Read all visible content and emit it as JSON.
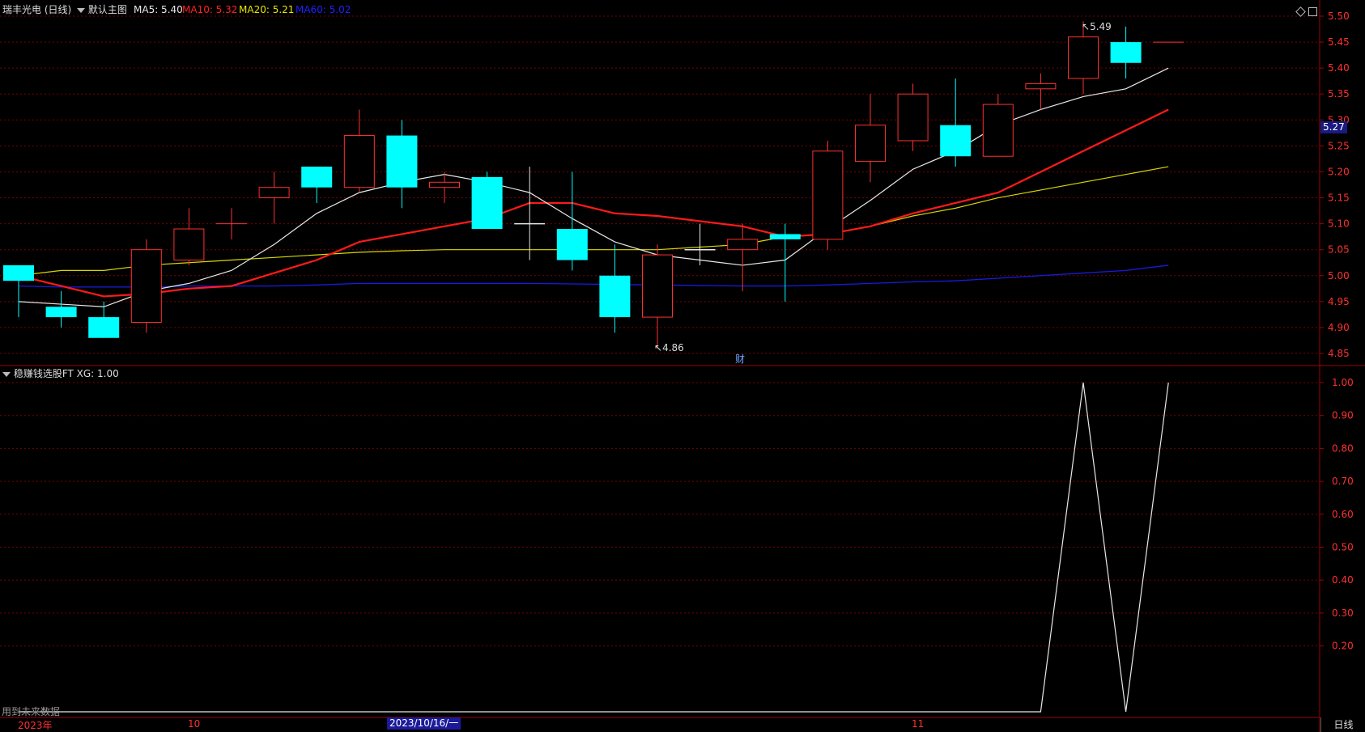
{
  "header": {
    "stock_name": "瑞丰光电 (日线)",
    "main_chart_label": "默认主图",
    "ma": [
      {
        "label": "MA5: 5.40",
        "color": "#e8e8e8"
      },
      {
        "label": "MA10: 5.32",
        "color": "#ff2020"
      },
      {
        "label": "MA20: 5.21",
        "color": "#e6e600"
      },
      {
        "label": "MA60: 5.02",
        "color": "#2020ff"
      }
    ]
  },
  "price_axis": {
    "ticks": [
      "5.50",
      "5.45",
      "5.40",
      "5.35",
      "5.30",
      "5.25",
      "5.20",
      "5.15",
      "5.10",
      "5.05",
      "5.00",
      "4.95",
      "4.90",
      "4.85"
    ],
    "current_price": "5.27"
  },
  "indicator": {
    "label": "稳赚钱选股FT  XG: 1.00",
    "ticks": [
      "1.00",
      "0.90",
      "0.80",
      "0.70",
      "0.60",
      "0.50",
      "0.40",
      "0.30",
      "0.20"
    ],
    "values": [
      0,
      0,
      0,
      0,
      0,
      0,
      0,
      0,
      0,
      0,
      0,
      0,
      0,
      0,
      0,
      0,
      0,
      0,
      0,
      0,
      0,
      0,
      0,
      0,
      0,
      1,
      0,
      1
    ]
  },
  "annotations": {
    "high": "5.49",
    "low": "4.86",
    "event": "财",
    "future_data": "用到未来数据"
  },
  "time_axis": {
    "labels": [
      "2023年",
      "10",
      "11"
    ],
    "selected_date": "2023/10/16/一",
    "period": "日线"
  },
  "chart_data": {
    "type": "candlestick",
    "ylim": [
      4.83,
      5.52
    ],
    "candles": [
      {
        "o": 4.99,
        "c": 5.02,
        "h": 5.02,
        "l": 4.92,
        "up": false
      },
      {
        "o": 4.94,
        "c": 4.92,
        "h": 4.97,
        "l": 4.9,
        "up": false
      },
      {
        "o": 4.92,
        "c": 4.88,
        "h": 4.95,
        "l": 4.88,
        "up": false
      },
      {
        "o": 4.91,
        "c": 5.05,
        "h": 5.07,
        "l": 4.89,
        "up": true
      },
      {
        "o": 5.03,
        "c": 5.09,
        "h": 5.13,
        "l": 5.02,
        "up": true
      },
      {
        "o": 5.1,
        "c": 5.1,
        "h": 5.13,
        "l": 5.07,
        "up": true
      },
      {
        "o": 5.15,
        "c": 5.17,
        "h": 5.2,
        "l": 5.1,
        "up": true
      },
      {
        "o": 5.21,
        "c": 5.17,
        "h": 5.21,
        "l": 5.14,
        "up": false
      },
      {
        "o": 5.17,
        "c": 5.27,
        "h": 5.32,
        "l": 5.16,
        "up": true
      },
      {
        "o": 5.27,
        "c": 5.17,
        "h": 5.3,
        "l": 5.13,
        "up": false
      },
      {
        "o": 5.17,
        "c": 5.18,
        "h": 5.2,
        "l": 5.14,
        "up": true
      },
      {
        "o": 5.19,
        "c": 5.09,
        "h": 5.2,
        "l": 5.09,
        "up": false
      },
      {
        "o": 5.1,
        "c": 5.1,
        "h": 5.21,
        "l": 5.03,
        "up": false
      },
      {
        "o": 5.09,
        "c": 5.03,
        "h": 5.2,
        "l": 5.01,
        "up": false
      },
      {
        "o": 5.0,
        "c": 4.92,
        "h": 5.06,
        "l": 4.89,
        "up": false
      },
      {
        "o": 4.92,
        "c": 5.04,
        "h": 5.06,
        "l": 4.86,
        "up": true
      },
      {
        "o": 5.05,
        "c": 5.05,
        "h": 5.1,
        "l": 5.02,
        "up": false
      },
      {
        "o": 5.05,
        "c": 5.07,
        "h": 5.1,
        "l": 4.97,
        "up": true
      },
      {
        "o": 5.08,
        "c": 5.07,
        "h": 5.1,
        "l": 4.95,
        "up": false
      },
      {
        "o": 5.07,
        "c": 5.24,
        "h": 5.26,
        "l": 5.05,
        "up": true
      },
      {
        "o": 5.22,
        "c": 5.29,
        "h": 5.35,
        "l": 5.18,
        "up": true
      },
      {
        "o": 5.26,
        "c": 5.35,
        "h": 5.37,
        "l": 5.24,
        "up": true
      },
      {
        "o": 5.29,
        "c": 5.23,
        "h": 5.38,
        "l": 5.21,
        "up": false
      },
      {
        "o": 5.23,
        "c": 5.33,
        "h": 5.35,
        "l": 5.23,
        "up": true
      },
      {
        "o": 5.36,
        "c": 5.37,
        "h": 5.39,
        "l": 5.32,
        "up": true
      },
      {
        "o": 5.38,
        "c": 5.46,
        "h": 5.49,
        "l": 5.35,
        "up": true
      },
      {
        "o": 5.45,
        "c": 5.41,
        "h": 5.48,
        "l": 5.38,
        "up": false
      },
      {
        "o": 5.45,
        "c": 5.45,
        "h": 5.45,
        "l": 5.45,
        "up": true
      }
    ],
    "ma5": [
      4.95,
      4.945,
      4.94,
      4.97,
      4.985,
      5.01,
      5.06,
      5.12,
      5.16,
      5.18,
      5.195,
      5.18,
      5.16,
      5.11,
      5.065,
      5.04,
      5.03,
      5.02,
      5.03,
      5.09,
      5.145,
      5.205,
      5.24,
      5.29,
      5.32,
      5.345,
      5.36,
      5.4
    ],
    "ma10": [
      5.0,
      4.98,
      4.96,
      4.965,
      4.975,
      4.98,
      5.005,
      5.03,
      5.065,
      5.08,
      5.095,
      5.11,
      5.14,
      5.14,
      5.12,
      5.115,
      5.105,
      5.095,
      5.075,
      5.08,
      5.095,
      5.12,
      5.14,
      5.16,
      5.2,
      5.24,
      5.28,
      5.32
    ],
    "ma20": [
      5.0,
      5.01,
      5.01,
      5.02,
      5.025,
      5.03,
      5.035,
      5.04,
      5.045,
      5.048,
      5.05,
      5.05,
      5.05,
      5.05,
      5.05,
      5.05,
      5.055,
      5.06,
      5.075,
      5.08,
      5.095,
      5.115,
      5.13,
      5.15,
      5.165,
      5.18,
      5.195,
      5.21
    ],
    "ma60": [
      4.98,
      4.978,
      4.978,
      4.978,
      4.98,
      4.98,
      4.98,
      4.982,
      4.985,
      4.985,
      4.985,
      4.985,
      4.985,
      4.984,
      4.983,
      4.982,
      4.981,
      4.98,
      4.98,
      4.982,
      4.985,
      4.988,
      4.99,
      4.995,
      5.0,
      5.005,
      5.01,
      5.02
    ]
  }
}
